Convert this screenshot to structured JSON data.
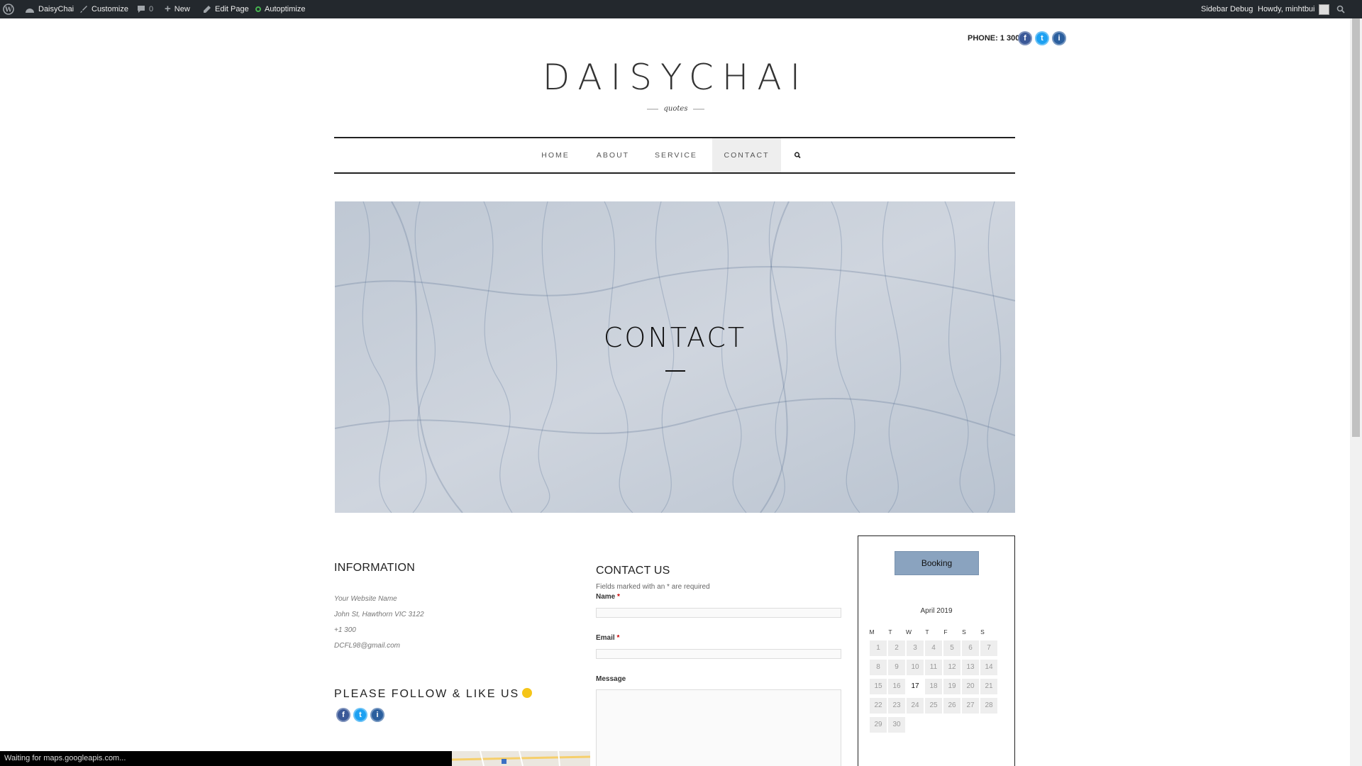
{
  "admin_bar": {
    "site_name": "DaisyChai",
    "customize": "Customize",
    "comments_count": "0",
    "new": "New",
    "edit_page": "Edit Page",
    "autoptimize": "Autoptimize",
    "sidebar_debug": "Sidebar Debug",
    "howdy": "Howdy, minhtbui"
  },
  "header": {
    "phone": "PHONE: 1 300",
    "site_title": "DAISYCHAI",
    "tagline": "quotes",
    "social": [
      "f",
      "t",
      "i"
    ]
  },
  "nav": {
    "items": [
      {
        "label": "HOME"
      },
      {
        "label": "ABOUT"
      },
      {
        "label": "SERVICE"
      },
      {
        "label": "CONTACT",
        "active": true
      }
    ]
  },
  "hero": {
    "title": "CONTACT"
  },
  "information": {
    "heading": "INFORMATION",
    "lines": [
      "Your Website Name",
      "John St, Hawthorn VIC 3122",
      "+1 300",
      "DCFL98@gmail.com"
    ],
    "follow_heading": "PLEASE FOLLOW & LIKE US"
  },
  "contact_form": {
    "heading": "CONTACT US",
    "note": "Fields marked with an * are required",
    "name_label": "Name",
    "email_label": "Email",
    "message_label": "Message",
    "required_mark": "*"
  },
  "sidebar": {
    "booking_label": "Booking",
    "calendar": {
      "month": "April 2019",
      "days_of_week": [
        "M",
        "T",
        "W",
        "T",
        "F",
        "S",
        "S"
      ],
      "days": [
        "1",
        "2",
        "3",
        "4",
        "5",
        "6",
        "7",
        "8",
        "9",
        "10",
        "11",
        "12",
        "13",
        "14",
        "15",
        "16",
        "17",
        "18",
        "19",
        "20",
        "21",
        "22",
        "23",
        "24",
        "25",
        "26",
        "27",
        "28",
        "29",
        "30"
      ],
      "today": "17"
    }
  },
  "status_bar": {
    "text": "Waiting for maps.googleapis.com..."
  },
  "colors": {
    "admin_bar": "#23282d",
    "booking_button": "#8aa3bf",
    "hero_background": "#c5cdd8",
    "facebook": "#3b5998",
    "twitter": "#1da1f2",
    "instagram": "#2b5f9e"
  }
}
